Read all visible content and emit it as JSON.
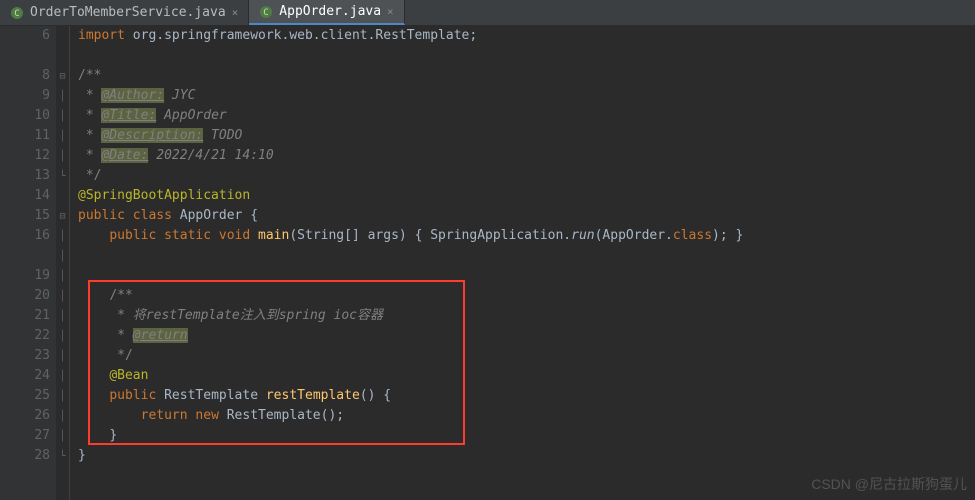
{
  "tabs": [
    {
      "label": "OrderToMemberService.java",
      "active": false
    },
    {
      "label": "AppOrder.java",
      "active": true
    }
  ],
  "gutter": {
    "lines": [
      "6",
      "",
      "8",
      "9",
      "10",
      "11",
      "12",
      "13",
      "14",
      "15",
      "16",
      "",
      "19",
      "20",
      "21",
      "22",
      "23",
      "24",
      "25",
      "26",
      "27",
      "28",
      ""
    ],
    "icons": {
      "l14": "bean",
      "l15": "bean-run",
      "l16": "run",
      "l20": "indent",
      "l24": "bean"
    }
  },
  "code": {
    "l6_import": "import",
    "l6_pkg": " org.springframework.web.client.RestTemplate;",
    "l8": "/**",
    "l9_star": " * ",
    "l9_tag": "@Author:",
    "l9_val": " JYC",
    "l10_star": " * ",
    "l10_tag": "@Title:",
    "l10_val": " AppOrder",
    "l11_star": " * ",
    "l11_tag": "@Description:",
    "l11_val": " TODO",
    "l12_star": " * ",
    "l12_tag": "@Date:",
    "l12_val": " 2022/4/21 14:10",
    "l13": " */",
    "l14_anno": "@SpringBootApplication",
    "l15_kw1": "public class ",
    "l15_cls": "AppOrder",
    "l15_brace": " {",
    "l16_pre": "    ",
    "l16_kw": "public static void ",
    "l16_m": "main",
    "l16_p1": "(String[] args) ",
    "l16_b1": "{ ",
    "l16_call": "SpringApplication.",
    "l16_run": "run",
    "l16_arg": "(AppOrder.",
    "l16_class": "class",
    "l16_end": "); ",
    "l16_b2": "}",
    "l20_pre": "    ",
    "l20": "/**",
    "l21_pre": "     ",
    "l21": "* 将restTemplate注入到spring ioc容器",
    "l22_pre": "     ",
    "l22_star": "* ",
    "l22_tag": "@return",
    "l23_pre": "     ",
    "l23": "*/",
    "l24_pre": "    ",
    "l24_anno": "@Bean",
    "l25_pre": "    ",
    "l25_kw": "public ",
    "l25_type": "RestTemplate ",
    "l25_m": "restTemplate",
    "l25_end": "() {",
    "l26_pre": "        ",
    "l26_kw": "return new ",
    "l26_type": "RestTemplate();",
    "l27_pre": "    ",
    "l27": "}",
    "l28": "}"
  },
  "watermark": "CSDN @尼古拉斯狗蛋儿"
}
